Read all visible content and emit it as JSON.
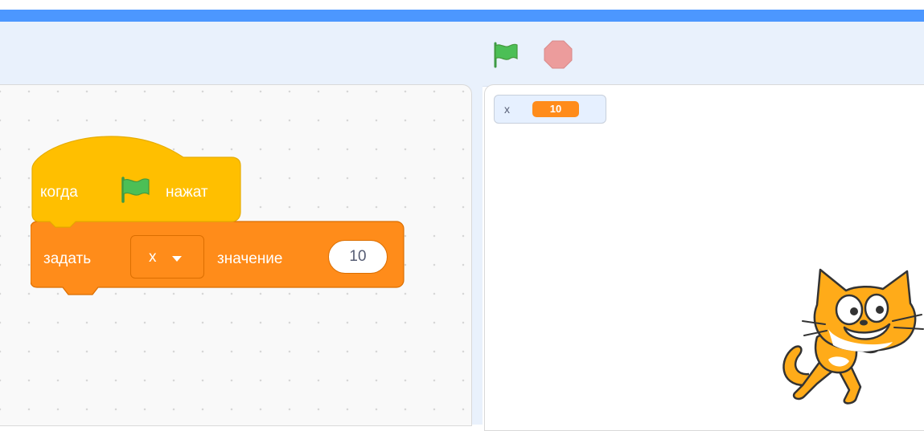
{
  "colors": {
    "menu_bar": "#4c97ff",
    "toolbar": "#e9f1fc",
    "events_block": "#ffbf00",
    "variables_block": "#ff8c1a",
    "green_flag": "#4cbf56",
    "stop": "#ec9c9c",
    "cat_orange": "#ffab19"
  },
  "toolbar": {
    "green_flag_icon": "green-flag-icon",
    "stop_icon": "stop-icon"
  },
  "script": {
    "hat_block": {
      "when_text": "когда",
      "flag_icon": "green-flag-icon",
      "clicked_text": "нажат"
    },
    "set_block": {
      "set_text": "задать",
      "variable": "x",
      "dropdown_icon": "caret-down-icon",
      "to_text": "значение",
      "value": "10"
    }
  },
  "stage": {
    "monitor": {
      "label": "x",
      "value": "10"
    },
    "sprite": "cat-sprite"
  }
}
